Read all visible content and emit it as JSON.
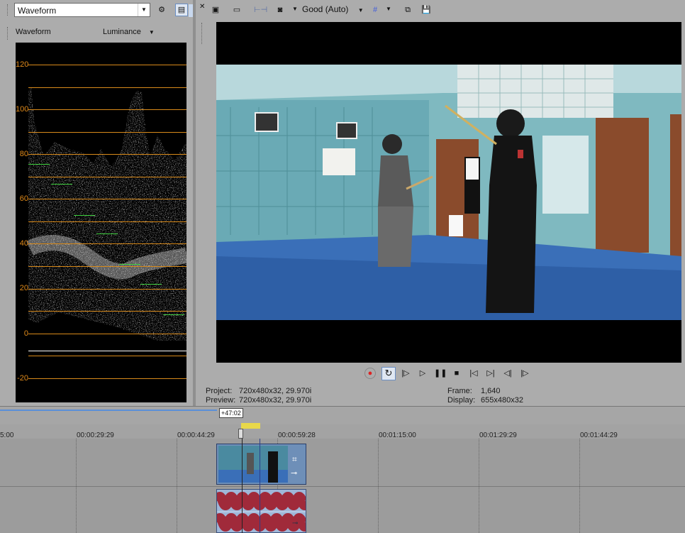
{
  "scopes": {
    "dropdown_value": "Waveform",
    "header_title": "Waveform",
    "mode_value": "Luminance",
    "y_labels": [
      "120",
      "100",
      "80",
      "60",
      "40",
      "20",
      "0",
      "-20"
    ]
  },
  "preview": {
    "quality_value": "Good (Auto)",
    "project_label": "Project:",
    "project_value": "720x480x32, 29.970i",
    "preview_label": "Preview:",
    "preview_value": "720x480x32, 29.970i",
    "frame_label": "Frame:",
    "frame_value": "1,640",
    "display_label": "Display:",
    "display_value": "655x480x32"
  },
  "timeline": {
    "selection_length": "+47:02",
    "ruler": [
      "5:00",
      "00:00:29:29",
      "00:00:44:29",
      "00:00:59:28",
      "00:01:15:00",
      "00:01:29:29",
      "00:01:44:29"
    ]
  },
  "colors": {
    "accent": "#4a7fc8",
    "audio": "#a02a3a",
    "scope_grid": "#d98a1a"
  }
}
